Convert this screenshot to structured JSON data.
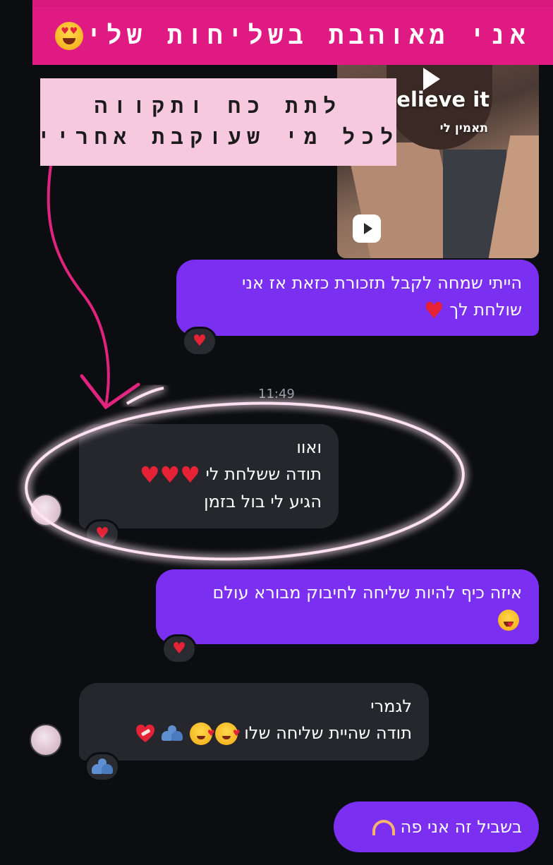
{
  "banner": {
    "text": "אני מאוהבת בשליחות שלי"
  },
  "note": {
    "line1": "לתת כח ותקווה",
    "line2": "לכל מי שעוקבת אחריי"
  },
  "video": {
    "caption": "believe it",
    "caption_he": "תאמין לי"
  },
  "messages": [
    {
      "direction": "outgoing",
      "lines": [
        "הייתי שמחה לקבל תזכורת כזאת אז אני",
        "שולחת לך"
      ],
      "reaction": "❤️"
    },
    {
      "direction": "incoming",
      "lines": [
        "ואוו",
        "תודה ששלחת לי",
        "הגיע לי בול בזמן"
      ],
      "reaction": "❤️"
    },
    {
      "direction": "outgoing",
      "lines": [
        "איזה כיף להיות שליחה לחיבוק מבורא עולם"
      ],
      "reaction": "❤️"
    },
    {
      "direction": "incoming",
      "lines": [
        "לגמרי",
        "תודה שהיית שליחה שלו"
      ],
      "reaction": "people"
    },
    {
      "direction": "outgoing",
      "lines": [
        "בשביל זה אני פה"
      ]
    }
  ],
  "timestamp": "11:49",
  "colors": {
    "banner": "#e01a83",
    "note": "#f7c9df",
    "outgoing": "#7b2ff0",
    "incoming": "#26272d",
    "annotation": "#e0247e"
  },
  "icons": [
    "heart-eyes-emoji",
    "green-heart-emoji",
    "red-heart-emoji",
    "people-emoji",
    "smiling-hearts-emoji",
    "mending-heart-emoji",
    "heart-hands-emoji",
    "reel-play-icon"
  ]
}
